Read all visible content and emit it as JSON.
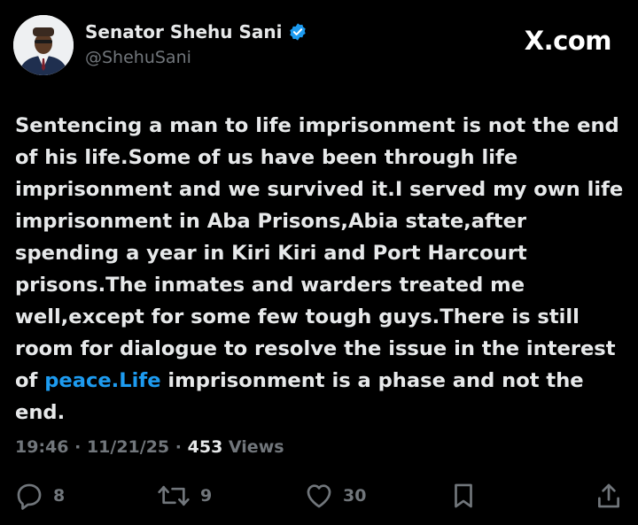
{
  "author": {
    "display_name": "Senator Shehu Sani",
    "handle": "@ShehuSani",
    "verified_icon": "verified-badge-icon"
  },
  "brand": "X.com",
  "post": {
    "text_before_link": "Sentencing a man to life imprisonment is not the end of his life.Some of us have been through life imprisonment and we survived it.I served my own life imprisonment in Aba Prisons,Abia state,after spending a year in Kiri Kiri and Port Harcourt prisons.The inmates and warders treated me well,except for some few tough guys.There is still room for dialogue to resolve the issue in the interest of ",
    "link_text": "peace.Life",
    "text_after_link": " imprisonment is a phase and not the end."
  },
  "meta": {
    "time": "19:46",
    "separator": "·",
    "date": "11/21/25",
    "views_count": "453",
    "views_label": "Views"
  },
  "actions": {
    "replies": "8",
    "reposts": "9",
    "likes": "30"
  },
  "colors": {
    "background": "#000000",
    "text": "#e7e9ea",
    "muted": "#71767b",
    "link": "#1d9bf0"
  }
}
